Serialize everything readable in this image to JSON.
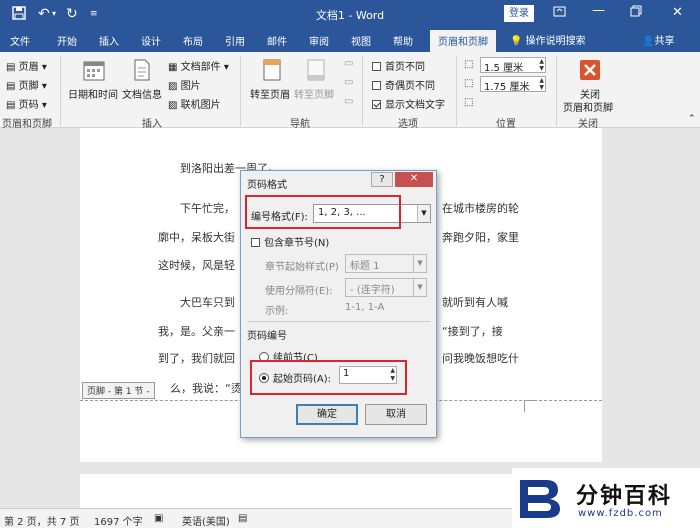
{
  "titlebar": {
    "title": "文档1 - Word",
    "login": "登录"
  },
  "menu": {
    "items": [
      "文件",
      "开始",
      "插入",
      "设计",
      "布局",
      "引用",
      "邮件",
      "审阅",
      "视图",
      "帮助"
    ],
    "active": "页眉和页脚",
    "tellme": "操作说明搜索",
    "share": "共享"
  },
  "ribbon": {
    "header": "页眉",
    "footer": "页脚",
    "pagenum": "页码",
    "group1": "页眉和页脚",
    "datetime": "日期和时间",
    "docinfo": "文档信息",
    "docparts": "文档部件",
    "picture": "图片",
    "onlinepic": "联机图片",
    "group2": "插入",
    "goto_header": "转至页眉",
    "goto_footer": "转至页脚",
    "group3": "导航",
    "opt1": "首页不同",
    "opt2": "奇偶页不同",
    "opt3": "显示文档文字",
    "group4": "选项",
    "pos1": "1.5 厘米",
    "pos2": "1.75 厘米",
    "group5": "位置",
    "close1": "关闭",
    "close2": "页眉和页脚",
    "group6": "关闭"
  },
  "doc": {
    "line1": "到洛阳出差一周了。",
    "line2": "下午忙完，",
    "line2r": "在城市楼房的轮",
    "line3": "廓中，呆板大街",
    "line3r": "奔跑夕阳，家里",
    "line4": "这时候，风是轻",
    "line5": "大巴车只到",
    "line5r": "就听到有人喊",
    "line6": "我，是。父亲一",
    "line6r": "“接到了，接",
    "line7": "到了，我们就回",
    "line7r": "问我晚饭想吃什",
    "line8": "么，我说：“烫",
    "footer_tag": "页脚 - 第 1 节 -"
  },
  "dialog": {
    "title": "页码格式",
    "help": "?",
    "format_label": "编号格式(F):",
    "format_value": "1, 2, 3, ...",
    "include_chapter": "包含章节号(N)",
    "chapter_style_label": "章节起始样式(P)",
    "chapter_style_value": "标题 1",
    "separator_label": "使用分隔符(E):",
    "separator_value": "-  (连字符)",
    "example_label": "示例:",
    "example_value": "1-1, 1-A",
    "numbering_label": "页码编号",
    "continue_label": "续前节(C)",
    "start_label": "起始页码(A):",
    "start_value": "1",
    "ok": "确定",
    "cancel": "取消"
  },
  "status": {
    "page": "第 2 页，共 7 页",
    "words": "1697 个字",
    "lang": "英语(美国)"
  },
  "watermark": {
    "brand": "分钟百科",
    "url": "www.fzdb.com"
  }
}
